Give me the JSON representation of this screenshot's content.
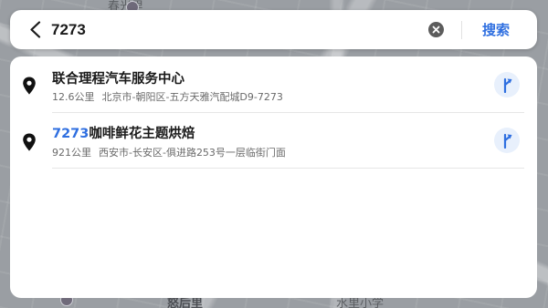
{
  "map": {
    "labels": [
      "春光里",
      "怒后里",
      "水里小学"
    ]
  },
  "search": {
    "query": "7273",
    "search_label": "搜索",
    "icons": {
      "back": "back-arrow-icon",
      "clear": "clear-icon"
    }
  },
  "results": [
    {
      "title_highlight": "",
      "title_rest": "联合理程汽车服务中心",
      "distance": "12.6公里",
      "address": "北京市-朝阳区-五方天雅汽配城D9-7273"
    },
    {
      "title_highlight": "7273",
      "title_rest": "咖啡鲜花主题烘焙",
      "distance": "921公里",
      "address": "西安市-长安区-俱进路253号一层临街门面"
    }
  ],
  "colors": {
    "accent": "#2f6fe0",
    "route_bg": "#e8f0fc"
  }
}
